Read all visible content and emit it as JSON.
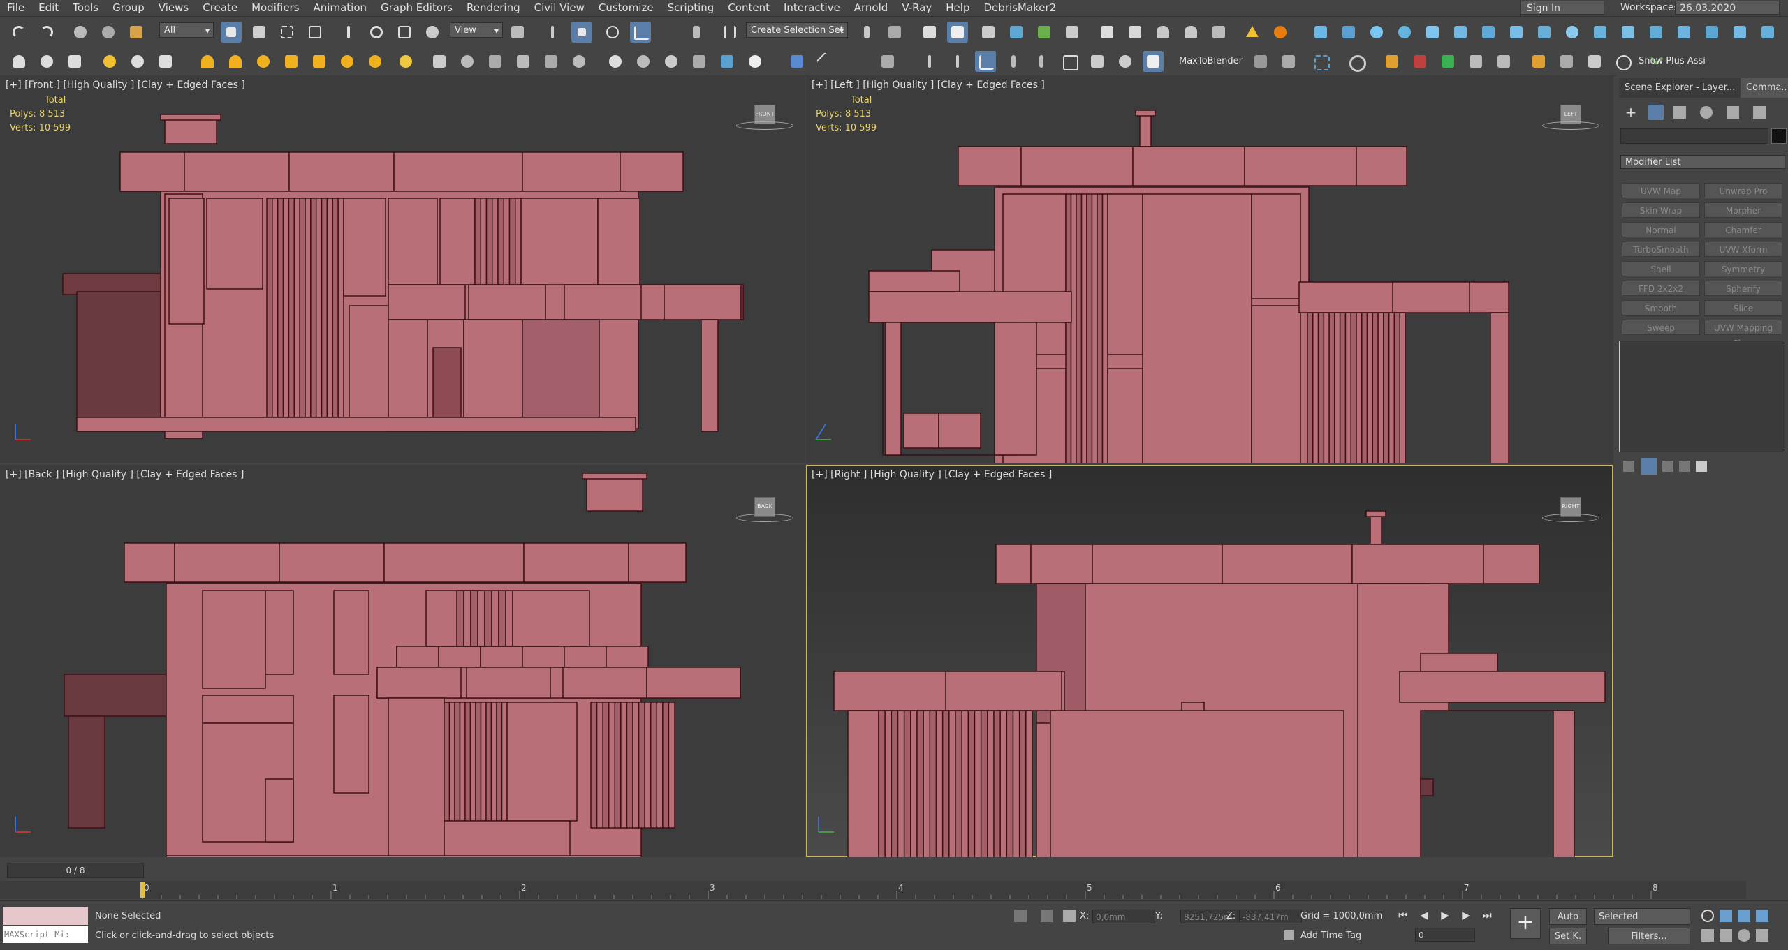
{
  "menubar": {
    "items": [
      "File",
      "Edit",
      "Tools",
      "Group",
      "Views",
      "Create",
      "Modifiers",
      "Animation",
      "Graph Editors",
      "Rendering",
      "Civil View",
      "Customize",
      "Scripting",
      "Content",
      "Interactive",
      "Arnold",
      "V-Ray",
      "Help",
      "DebrisMaker2"
    ],
    "sign_in": "Sign In",
    "workspaces_label": "Workspaces:",
    "workspaces_value": "26.03.2020"
  },
  "toolbar": {
    "filter_value": "All",
    "ref_coord_value": "View",
    "selection_set_value": "Create Selection Set",
    "max_to_blender": "MaxToBlender",
    "snow_plus": "Snow Plus Assi"
  },
  "viewports": {
    "front": {
      "label": "[+] [Front ] [High Quality ] [Clay + Edged Faces ]",
      "cube": "FRONT"
    },
    "left": {
      "label": "[+] [Left ] [High Quality ] [Clay + Edged Faces ]",
      "cube": "LEFT"
    },
    "back": {
      "label": "[+] [Back ] [High Quality ] [Clay + Edged Faces ]",
      "cube": "BACK"
    },
    "right": {
      "label": "[+] [Right ] [High Quality ] [Clay + Edged Faces ]",
      "cube": "RIGHT"
    },
    "stats": {
      "total": "Total",
      "polys_label": "Polys:",
      "polys": "8 513",
      "verts_label": "Verts:",
      "verts": "10 599"
    }
  },
  "command_panel": {
    "tab_scene": "Scene Explorer - Layer...",
    "tab_command": "Comma...",
    "modifier_list": "Modifier List",
    "modifiers": [
      "UVW Map",
      "Unwrap Pro",
      "Skin Wrap",
      "Morpher",
      "Normal",
      "Chamfer",
      "TurboSmooth",
      "UVW Xform",
      "Shell",
      "Symmetry",
      "FFD 2x2x2",
      "Spherify",
      "Smooth",
      "Slice",
      "Sweep",
      "UVW Mapping Clear"
    ]
  },
  "timeline": {
    "frame_counter": "0 / 8",
    "ticks": [
      "0",
      "1",
      "2",
      "3",
      "4",
      "5",
      "6",
      "7",
      "8"
    ]
  },
  "status": {
    "maxscript": "MAXScript Mi:",
    "selection": "None Selected",
    "prompt": "Click or click-and-drag to select objects",
    "x_label": "X:",
    "x_value": "0,0mm",
    "y_label": "Y:",
    "y_value": "8251,725m",
    "z_label": "Z:",
    "z_value": "-837,417m",
    "grid": "Grid = 1000,0mm",
    "add_time_tag": "Add Time Tag",
    "auto": "Auto",
    "selected": "Selected",
    "set_key": "Set K.",
    "filters": "Filters...",
    "frame_field": "0"
  },
  "colors": {
    "model_fill": "#b96f78",
    "model_line": "#3a1216",
    "viewport_bg": "#3c3c3c",
    "active_border": "#c8b56a"
  }
}
